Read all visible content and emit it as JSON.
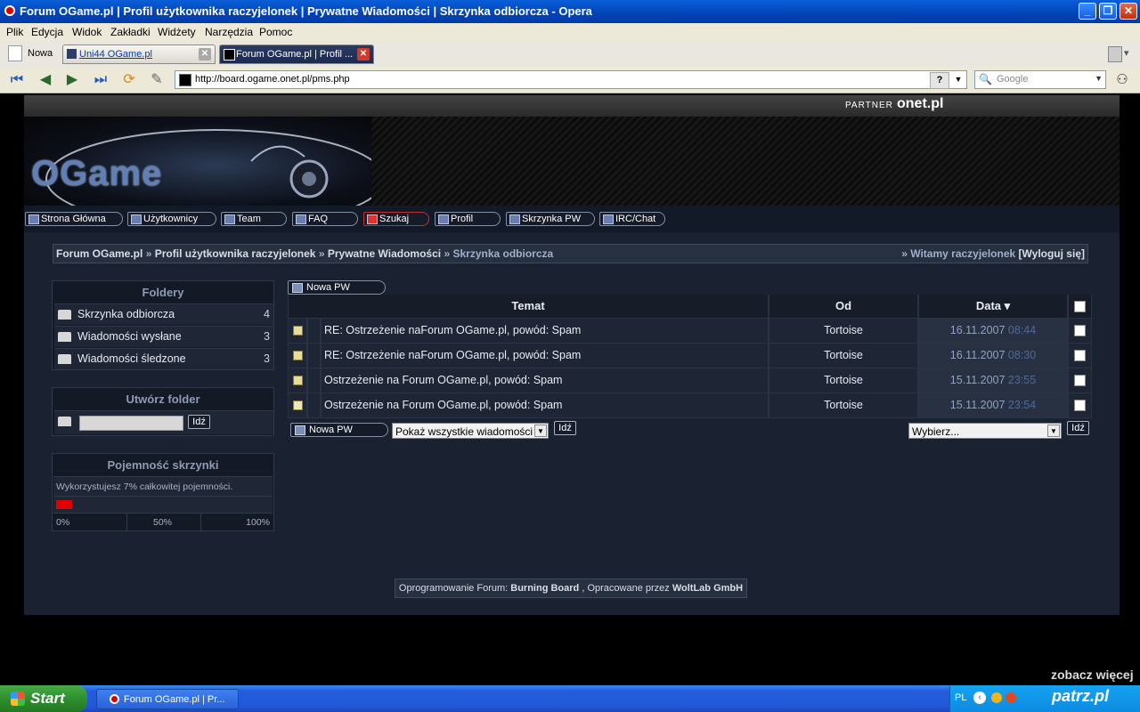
{
  "window": {
    "title": "Forum OGame.pl | Profil użytkownika raczyjelonek | Prywatne Wiadomości | Skrzynka odbiorcza - Opera",
    "buttons": [
      "_",
      "❐",
      "✕"
    ]
  },
  "menu": [
    "Plik",
    "Edycja",
    "Widok",
    "Zakładki",
    "Widżety",
    "Narzędzia",
    "Pomoc"
  ],
  "tabs": {
    "new_label": "Nowa",
    "items": [
      {
        "label": "Uni44 OGame.pl"
      },
      {
        "label": "Forum OGame.pl | Profil ..."
      }
    ]
  },
  "address": {
    "url": "http://board.ogame.onet.pl/pms.php",
    "help": "?",
    "search_placeholder": "Google"
  },
  "partner": {
    "label": "PARTNER",
    "brand": "onet.pl"
  },
  "logo": {
    "text": "OGame"
  },
  "site_nav": [
    "Strona Główna",
    "Użytkownicy",
    "Team",
    "FAQ",
    "Szukaj",
    "Profil",
    "Skrzynka PW",
    "IRC/Chat"
  ],
  "breadcrumb": {
    "items": [
      "Forum OGame.pl",
      "Profil użytkownika raczyjelonek",
      "Prywatne Wiadomości"
    ],
    "current": "Skrzynka odbiorcza",
    "sep": "»",
    "welcome": "» Witamy raczyjelonek",
    "logout": "Wyloguj się",
    "bracket_open": "[",
    "bracket_close": "]"
  },
  "folders": {
    "title": "Foldery",
    "items": [
      {
        "name": "Skrzynka odbiorcza",
        "count": "4"
      },
      {
        "name": "Wiadomości wysłane",
        "count": "3"
      },
      {
        "name": "Wiadomości śledzone",
        "count": "3"
      }
    ]
  },
  "create_folder": {
    "title": "Utwórz folder",
    "go": "Idź"
  },
  "capacity": {
    "title": "Pojemność skrzynki",
    "text": "Wykorzystujesz 7% całkowitej pojemności.",
    "percent": 7,
    "scale": [
      "0%",
      "50%",
      "100%"
    ],
    "bar_color": "#e00000"
  },
  "messages": {
    "new_pm": "Nowa PW",
    "columns": {
      "subject": "Temat",
      "from": "Od",
      "date": "Data ▾"
    },
    "rows": [
      {
        "subject": "RE: Ostrzeżenie naForum OGame.pl, powód: Spam",
        "from": "Tortoise",
        "date": "16.11.2007",
        "time": "08:44"
      },
      {
        "subject": "RE: Ostrzeżenie naForum OGame.pl, powód: Spam",
        "from": "Tortoise",
        "date": "16.11.2007",
        "time": "08:30"
      },
      {
        "subject": "Ostrzeżenie na Forum OGame.pl, powód: Spam",
        "from": "Tortoise",
        "date": "15.11.2007",
        "time": "23:55"
      },
      {
        "subject": "Ostrzeżenie na Forum OGame.pl, powód: Spam",
        "from": "Tortoise",
        "date": "15.11.2007",
        "time": "23:54"
      }
    ],
    "filter_value": "Pokaż wszystkie wiadomości",
    "go": "Idź",
    "action_value": "Wybierz...",
    "action_go": "Idź"
  },
  "footer": {
    "prefix": "Oprogramowanie Forum:",
    "product": "Burning Board",
    "middle": ", Opracowane przez",
    "company": "WoltLab GmbH"
  },
  "taskbar": {
    "start": "Start",
    "task": "Forum OGame.pl | Pr...",
    "lang": "PL",
    "watermark_top": "zobacz więcej",
    "watermark_brand": "patrz.pl"
  }
}
